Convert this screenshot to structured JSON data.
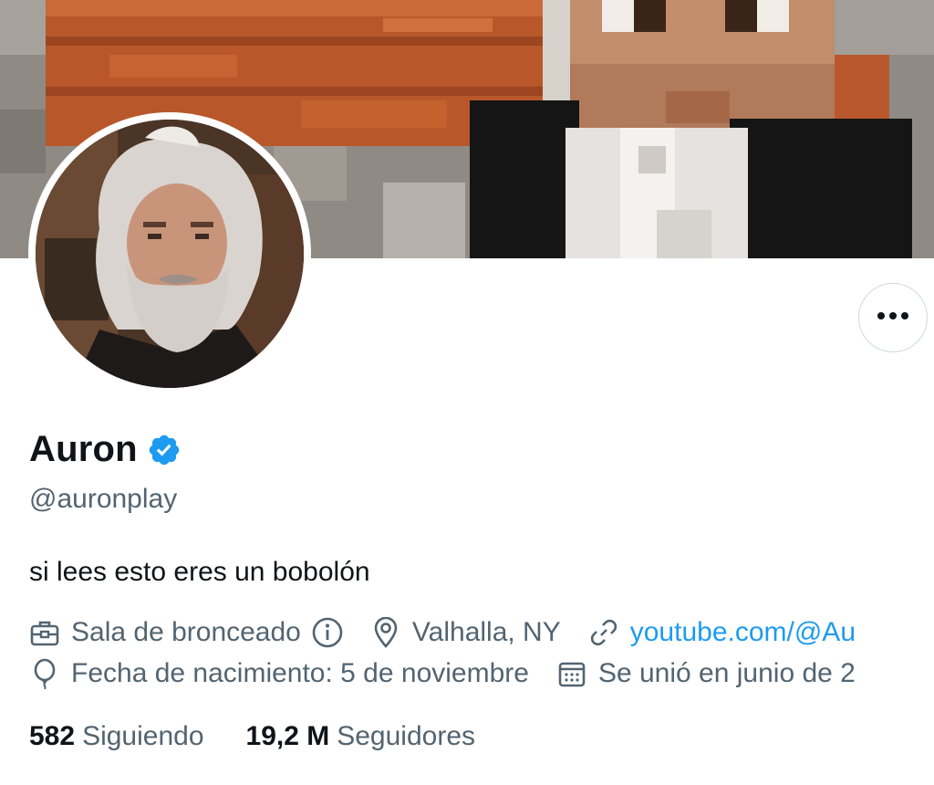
{
  "profile": {
    "display_name": "Auron",
    "handle": "@auronplay",
    "bio": "si lees esto eres un bobolón",
    "verified_icon": "verified-badge-icon",
    "accent": "#1d9bf0"
  },
  "meta": {
    "profession": "Sala de bronceado",
    "location": "Valhalla, NY",
    "website": "youtube.com/@Au",
    "birthday": "Fecha de nacimiento: 5 de noviembre",
    "joined": "Se unió en junio de 2"
  },
  "stats": {
    "following_count": "582",
    "following_label": "Siguiendo",
    "followers_count": "19,2 M",
    "followers_label": "Seguidores"
  },
  "icons": {
    "more": "more-options-icon",
    "profession": "briefcase-icon",
    "info": "info-icon",
    "location": "location-pin-icon",
    "link": "link-icon",
    "birthday": "balloon-icon",
    "calendar": "calendar-icon"
  }
}
